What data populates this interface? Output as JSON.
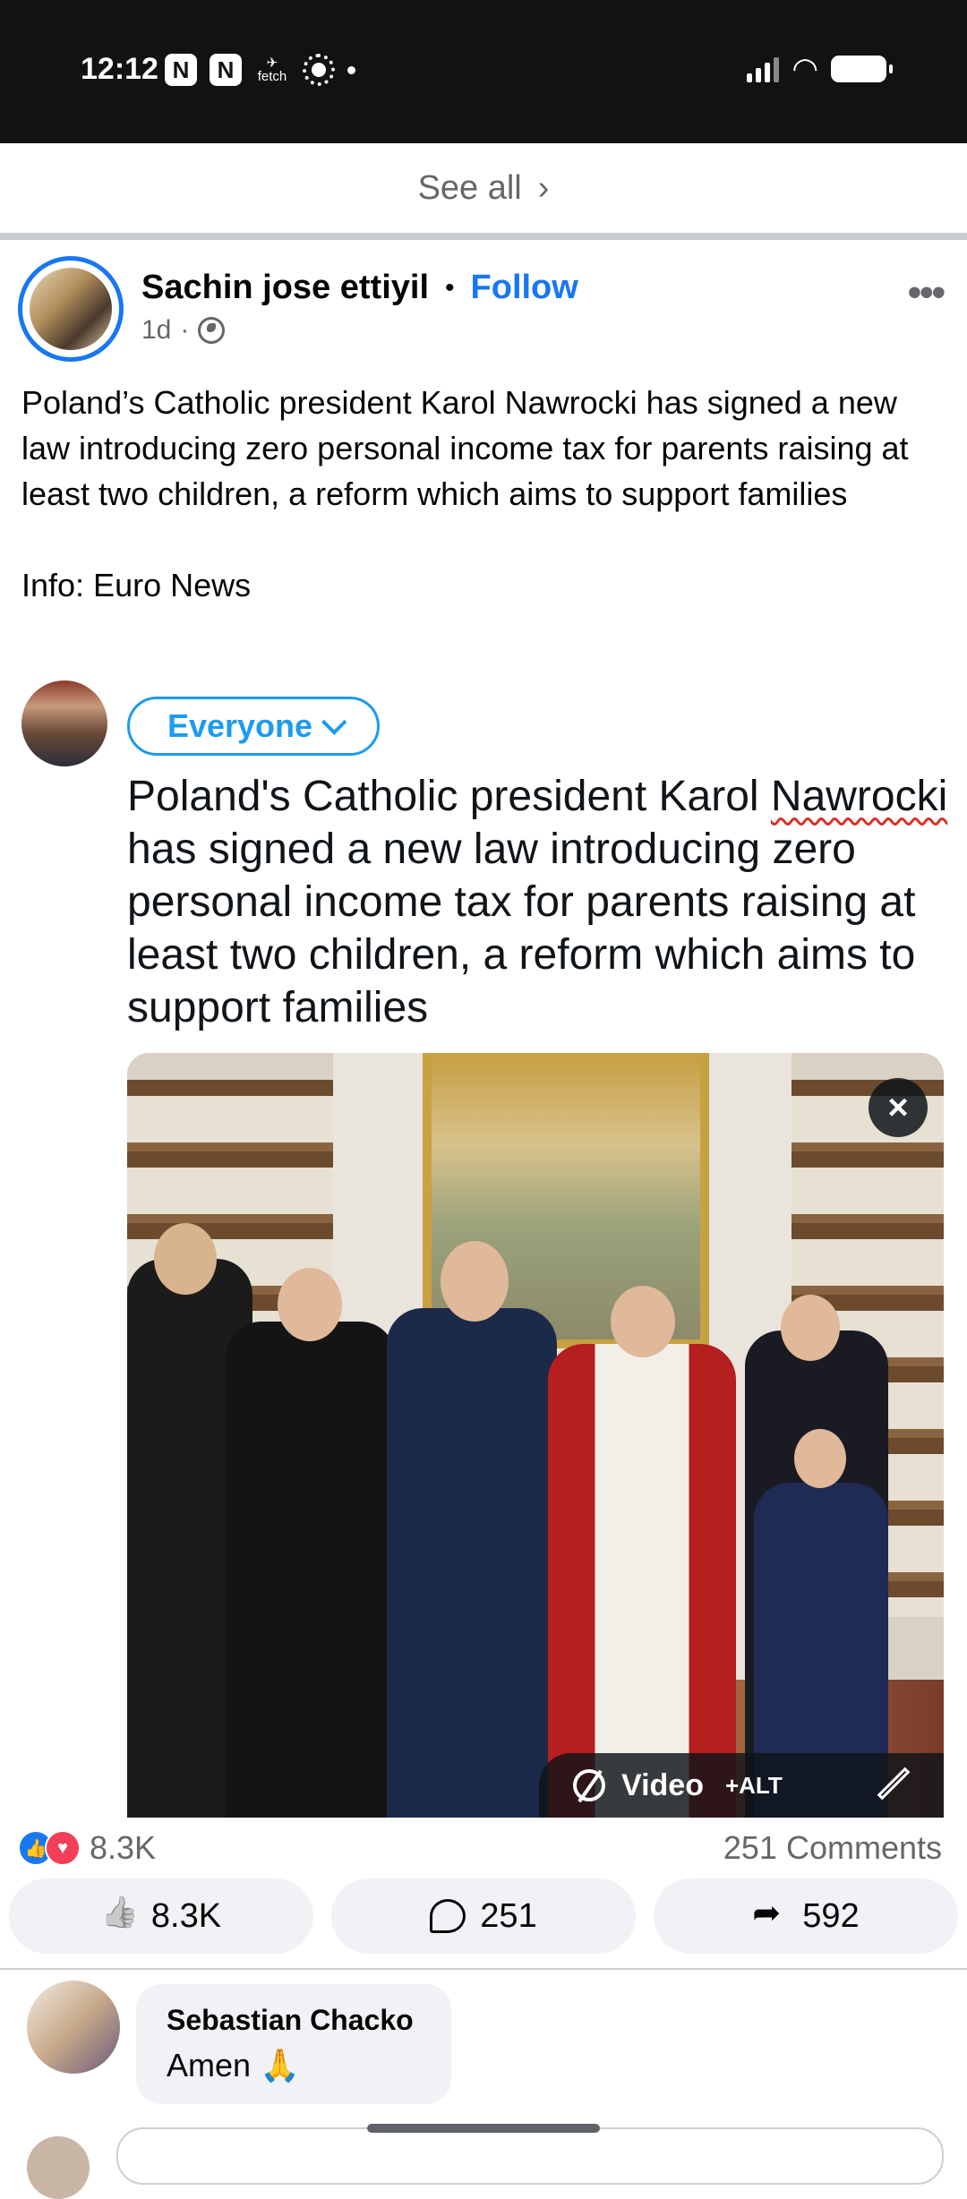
{
  "status_bar": {
    "time": "12:12",
    "fetch_label": "fetch"
  },
  "see_all": {
    "label": "See all"
  },
  "post": {
    "author": "Sachin jose ettiyil",
    "follow_label": "Follow",
    "time_ago": "1d",
    "caption": "Poland’s Catholic president Karol Nawrocki has signed a new law introducing zero personal income tax for parents raising at least two children, a reform which aims to support families",
    "source": "Info: Euro News"
  },
  "embed": {
    "audience_label": "Everyone",
    "text_before": "Poland's Catholic president Karol ",
    "text_underlined": "Nawrocki",
    "text_after": " has signed a new law introducing zero personal income tax for parents raising at least two children, a reform which aims to support families",
    "close_symbol": "×",
    "toolbar_video_label": "Video",
    "toolbar_alt_label": "+ALT"
  },
  "stats": {
    "reactions": "8.3K",
    "comments": "251 Comments"
  },
  "actions": {
    "like_count": "8.3K",
    "comment_count": "251",
    "share_count": "592"
  },
  "comment": {
    "author": "Sebastian Chacko",
    "text": "Amen 🙏"
  }
}
